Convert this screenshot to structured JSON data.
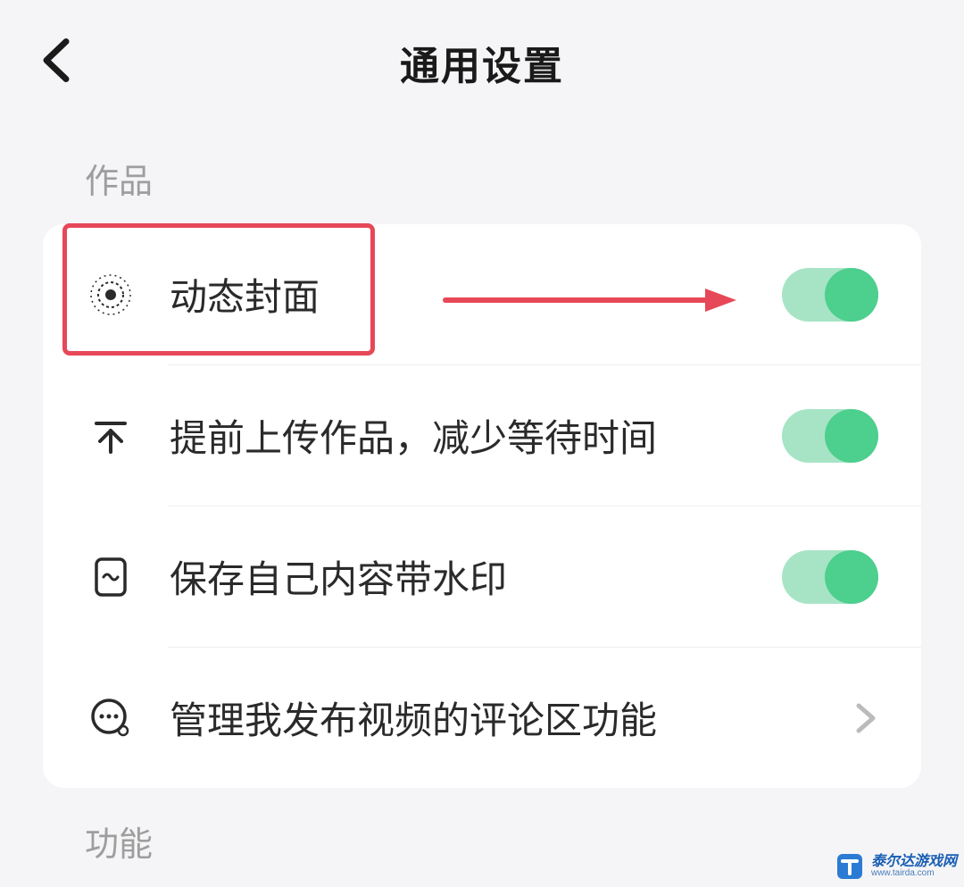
{
  "header": {
    "title": "通用设置"
  },
  "sections": {
    "works": {
      "label": "作品",
      "items": [
        {
          "label": "动态封面",
          "type": "toggle",
          "enabled": true
        },
        {
          "label": "提前上传作品，减少等待时间",
          "type": "toggle",
          "enabled": true
        },
        {
          "label": "保存自己内容带水印",
          "type": "toggle",
          "enabled": true
        },
        {
          "label": "管理我发布视频的评论区功能",
          "type": "nav"
        }
      ]
    },
    "features": {
      "label": "功能"
    }
  },
  "watermark": {
    "title": "泰尔达游戏网",
    "url": "www.tairda.com"
  }
}
